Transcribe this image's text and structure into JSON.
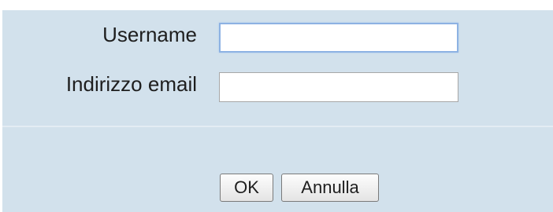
{
  "form": {
    "username_label": "Username",
    "username_value": "",
    "email_label": "Indirizzo email",
    "email_value": ""
  },
  "actions": {
    "ok_label": "OK",
    "cancel_label": "Annulla"
  },
  "colors": {
    "panel_background": "#d2e1ec",
    "focus_border": "#8db2e3"
  }
}
